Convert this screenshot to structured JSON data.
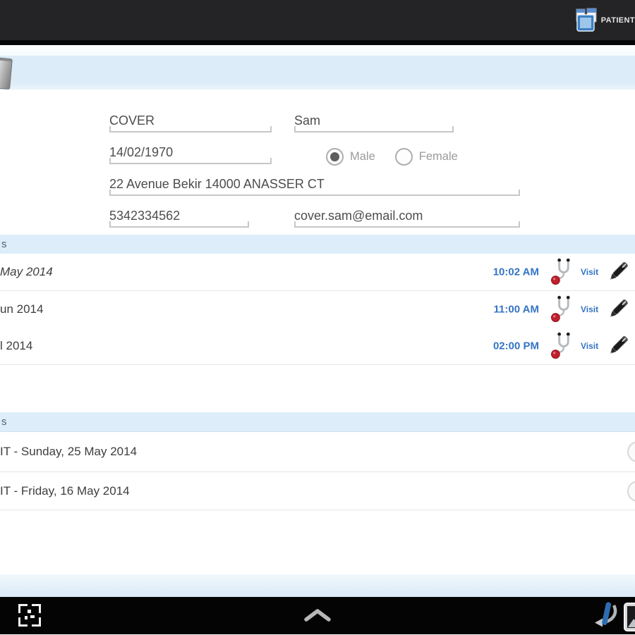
{
  "app": {
    "title": "PATIENT"
  },
  "patient": {
    "last_name": "COVER",
    "first_name": "Sam",
    "birth_date": "14/02/1970",
    "gender": {
      "male_label": "Male",
      "female_label": "Female",
      "selected": "Male"
    },
    "address": "22 Avenue Bekir 14000 ANASSER CT",
    "phone": "5342334562",
    "email": "cover.sam@email.com"
  },
  "appointments": {
    "header_fragment": "s",
    "rows": [
      {
        "date_fragment": "May 2014",
        "time": "10:02 AM",
        "action_label": "Visit"
      },
      {
        "date_fragment": "un 2014",
        "time": "11:00 AM",
        "action_label": "Visit"
      },
      {
        "date_fragment": "l 2014",
        "time": "02:00 PM",
        "action_label": "Visit"
      }
    ]
  },
  "visits": {
    "header_fragment": "s",
    "rows": [
      {
        "label_fragment": "IT - Sunday, 25 May 2014"
      },
      {
        "label_fragment": "IT - Friday, 16 May 2014"
      }
    ]
  },
  "colors": {
    "accent_blue": "#3474c4",
    "section_bar_bg": "#ddeefa",
    "patient_header_bg": "#dcecf8",
    "topbar_bg": "#242426",
    "navbar_bg": "#040404"
  }
}
